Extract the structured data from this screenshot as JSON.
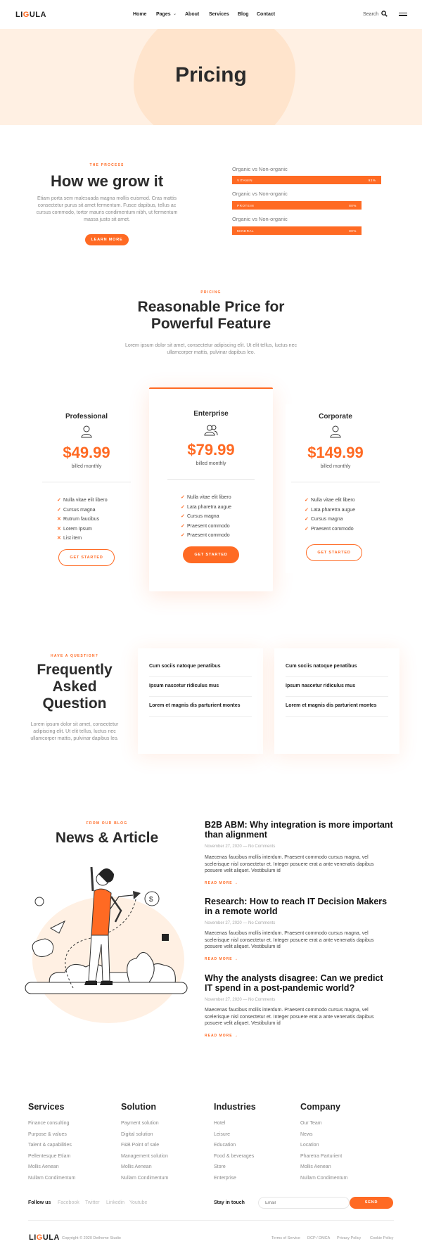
{
  "header": {
    "logo_a": "LI",
    "logo_b": "G",
    "logo_c": "ULA",
    "nav": [
      "Home",
      "Pages",
      "About",
      "Services",
      "Blog",
      "Contact"
    ],
    "search_label": "Search",
    "icons": [
      "search-icon",
      "menu-icon",
      "chevron-down-icon"
    ]
  },
  "hero": {
    "title": "Pricing"
  },
  "process": {
    "eyebrow": "THE PROCESS",
    "title": "How we grow it",
    "text_1": "Etiam porta sem malesuada magna mollis euismod. Cras mattis",
    "text_2": "consectetur purus sit amet fermentum. Fusce dapibus, tellus ac",
    "text_3": "cursus commodo, tortor mauris condimentum nibh, ut fermentum",
    "text_4": "massa justo sit amet.",
    "button": "LEARN MORE",
    "bars": [
      {
        "title": "Organic vs Non-organic",
        "label": "VITAMIN",
        "percent": 0.92,
        "percent_label": "92%"
      },
      {
        "title": "Organic vs Non-organic",
        "label": "PROTEIN",
        "percent": 0.8,
        "percent_label": "80%"
      },
      {
        "title": "Organic vs Non-organic",
        "label": "MINERAL",
        "percent": 0.8,
        "percent_label": "80%"
      }
    ]
  },
  "pricing": {
    "eyebrow": "PRICING",
    "title_1": "Reasonable Price for",
    "title_2": "Powerful Feature",
    "text_1": "Lorem ipsum dolor sit amet, consectetur adipiscing elit. Ut elit tellus, luctus nec",
    "text_2": "ullamcorper mattis, pulvinar dapibus leo.",
    "plans": [
      {
        "name": "Professional",
        "icon": "person-icon",
        "price": "$49.99",
        "billing": "billed monthly",
        "features": [
          {
            "text": "Nulla vitae elit libero",
            "included": true
          },
          {
            "text": "Cursus magna",
            "included": true
          },
          {
            "text": "Rutrum faucibus",
            "included": false
          },
          {
            "text": "Lorem Ipsum",
            "included": false
          },
          {
            "text": "List item",
            "included": false
          }
        ],
        "button": "GET STARTED"
      },
      {
        "name": "Enterprise",
        "icon": "people-icon",
        "price": "$79.99",
        "billing": "billed monthly",
        "features": [
          {
            "text": "Nulla vitae elit libero",
            "included": true
          },
          {
            "text": "Lata pharetra augue",
            "included": true
          },
          {
            "text": "Cursus magna",
            "included": true
          },
          {
            "text": "Praesent commodo",
            "included": true
          },
          {
            "text": "Praesent commodo",
            "included": true
          }
        ],
        "button": "GET STARTED"
      },
      {
        "name": "Corporate",
        "icon": "person-icon",
        "price": "$149.99",
        "billing": "billed monthly",
        "features": [
          {
            "text": "Nulla vitae elit libero",
            "included": true
          },
          {
            "text": "Lata pharetra augue",
            "included": true
          },
          {
            "text": "Cursus magna",
            "included": true
          },
          {
            "text": "Praesent commodo",
            "included": true
          }
        ],
        "button": "GET STARTED"
      }
    ]
  },
  "faq": {
    "eyebrow": "HAVE A QUESTION?",
    "title_1": "Frequently",
    "title_2": "Asked",
    "title_3": "Question",
    "text_1": "Lorem ipsum dolor sit amet, consectetur",
    "text_2": "adipiscing elit. Ut elit tellus, luctus nec",
    "text_3": "ullamcorper mattis, pulvinar dapibus leo.",
    "left": [
      "Cum sociis natoque penatibus",
      "Ipsum nascetur ridiculus mus",
      "Lorem et magnis dis parturient montes"
    ],
    "right": [
      "Cum sociis natoque penatibus",
      "Ipsum nascetur ridiculus mus",
      "Lorem et magnis dis parturient montes"
    ]
  },
  "news": {
    "eyebrow": "FROM OUR BLOG",
    "title": "News & Article",
    "read_more": "READ MORE →",
    "body_1": "Maecenas faucibus mollis interdum. Praesent commodo cursus magna, vel",
    "body_2": "scelerisque nisl consectetur et. Integer posuere erat a ante venenatis dapibus",
    "body_3": "posuere velit aliquet. Vestibulum id",
    "meta": "November 27, 2020 — No Comments",
    "articles": [
      {
        "title_1": "B2B ABM: Why integration is more important",
        "title_2": "than alignment"
      },
      {
        "title_1": "Research: How to reach IT Decision Makers",
        "title_2": "in a remote world"
      },
      {
        "title_1": "Why the analysts disagree: Can we predict",
        "title_2": "IT spend in a post-pandemic world?"
      }
    ]
  },
  "footer": {
    "columns": [
      {
        "title": "Services",
        "links": [
          "Finance consulting",
          "Purpose & values",
          "Talent & capabilities",
          "Pellentesque Etiam",
          "Mollis Aenean",
          "Nullam Condimentum"
        ]
      },
      {
        "title": "Solution",
        "links": [
          "Payment solution",
          "Digital solution",
          "F&B Point of sale",
          "Management solution",
          "Mollis Aenean",
          "Nullam Condimentum"
        ]
      },
      {
        "title": "Industries",
        "links": [
          "Hotel",
          "Leisure",
          "Education",
          "Food & beverages",
          "Store",
          "Enterprise"
        ]
      },
      {
        "title": "Company",
        "links": [
          "Our Team",
          "News",
          "Location",
          "Pharetra Parturient",
          "Mollis Aenean",
          "Nullam Condimentum"
        ]
      }
    ],
    "follow_label": "Follow us",
    "social": [
      "Facebook",
      "Twitter",
      "Linkedin",
      "Youtube"
    ],
    "stay_label": "Stay in touch",
    "email_placeholder": "Email",
    "send": "SEND",
    "copyright": "Copyright © 2020 Detheme Studio",
    "legal": [
      "Terms of Service",
      "DCP / DMCA",
      "Privacy Policy",
      "Cookie Policy"
    ]
  },
  "colors": {
    "accent": "#ff6a23",
    "hero_bg": "#fff0e3",
    "text": "#2b2b2b"
  }
}
